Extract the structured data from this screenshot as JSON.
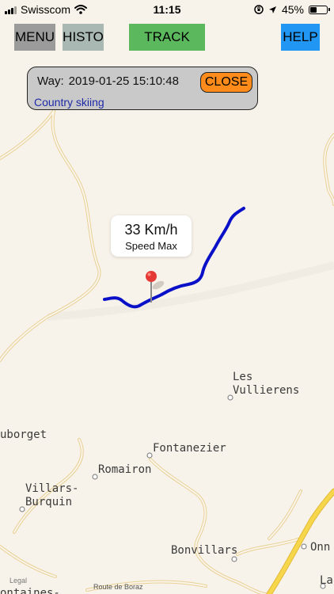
{
  "status_bar": {
    "carrier": "Swisscom",
    "time": "11:15",
    "battery_percent": "45%",
    "battery_level": 0.45,
    "icons": [
      "signal-icon",
      "wifi-icon",
      "orientation-lock-icon",
      "location-arrow-icon",
      "battery-icon"
    ]
  },
  "toolbar": {
    "menu_label": "MENU",
    "histo_label": "HISTO",
    "track_label": "TRACK",
    "help_label": "HELP"
  },
  "info_panel": {
    "way_label": "Way:",
    "way_datetime": "2019-01-25 15:10:48",
    "close_label": "CLOSE",
    "activity": "Country skiing"
  },
  "callout": {
    "speed": "33 Km/h",
    "label": "Speed Max"
  },
  "map": {
    "places": {
      "les_vullierens": [
        "Les",
        "Vullierens"
      ],
      "uborget": "uborget",
      "fontanezier": "Fontanezier",
      "romairon": "Romairon",
      "villars_burquin": [
        "Villars-",
        "Burquin"
      ],
      "bonvillars": "Bonvillars",
      "onn": "Onn",
      "la": "La",
      "ontaines": "ontaines-"
    },
    "road_label": "Route de Boraz",
    "legal": "Legal",
    "colors": {
      "track": "#0a10c8",
      "pin": "#e53935",
      "road_main": "#f6d64a",
      "road_minor": "#efd69b"
    }
  },
  "colors": {
    "menu_button": "#9b9b9b",
    "histo_button": "#a9b8b2",
    "track_button": "#5cb85c",
    "help_button": "#2196f3",
    "close_button": "#ff8c1a",
    "activity_text": "#1f2aa8"
  }
}
